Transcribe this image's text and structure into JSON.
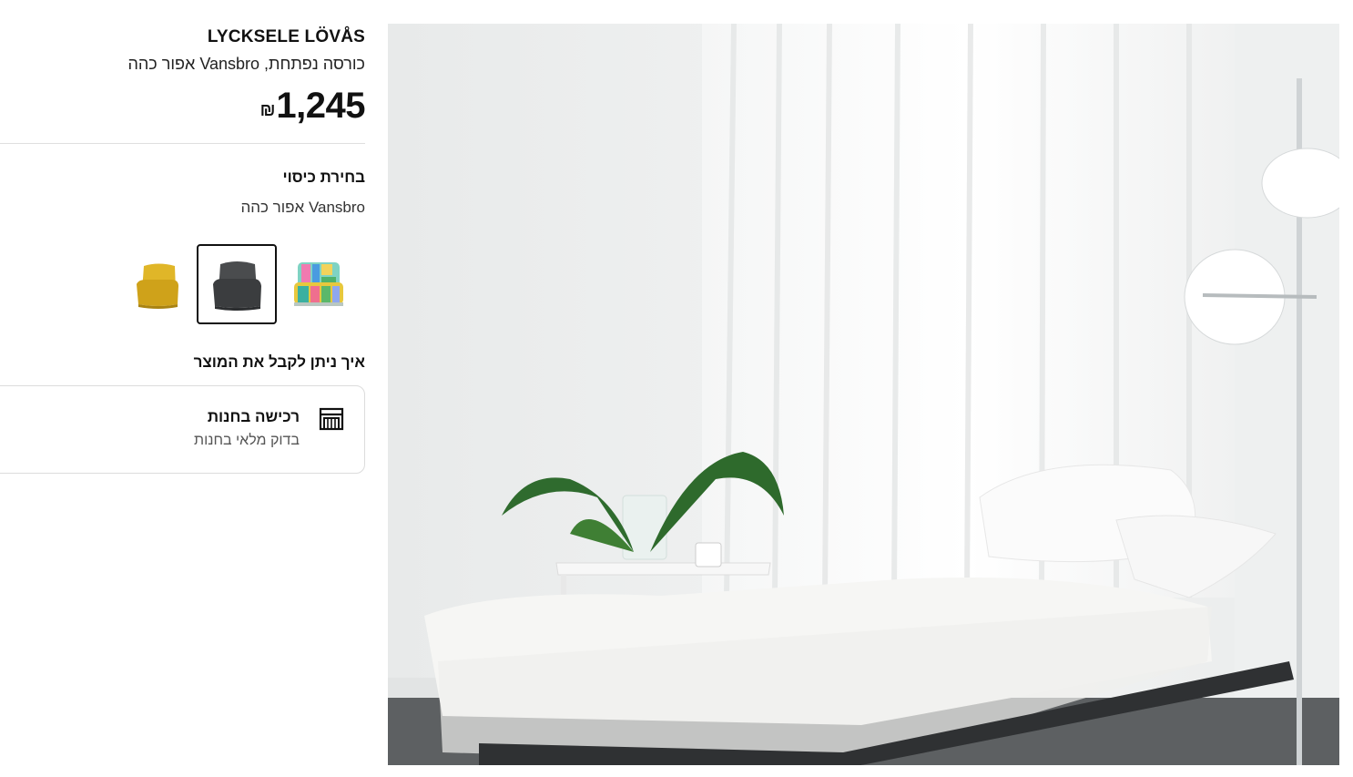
{
  "product": {
    "name": "LYCKSELE LÖVÅS",
    "description": "כורסה נפתחת, Vansbro אפור כהה",
    "price_currency": "₪",
    "price_amount": "1,245"
  },
  "cover": {
    "heading": "בחירת כיסוי",
    "selected_value": "Vansbro אפור כהה",
    "swatches": [
      {
        "name": "multicolor",
        "color": "#5cb88a",
        "selected": false
      },
      {
        "name": "dark-grey",
        "color": "#3d3f40",
        "selected": true
      },
      {
        "name": "yellow",
        "color": "#d8ac1c",
        "selected": false
      }
    ]
  },
  "delivery": {
    "heading": "איך ניתן לקבל את המוצר",
    "store_title": "רכישה בחנות",
    "store_subtitle": "בדוק מלאי בחנות",
    "icon": "store-icon"
  },
  "colors": {
    "text": "#111111",
    "border": "#dcdcdc",
    "selected_border": "#111111"
  },
  "hero_image": {
    "icon": "product-photo"
  }
}
